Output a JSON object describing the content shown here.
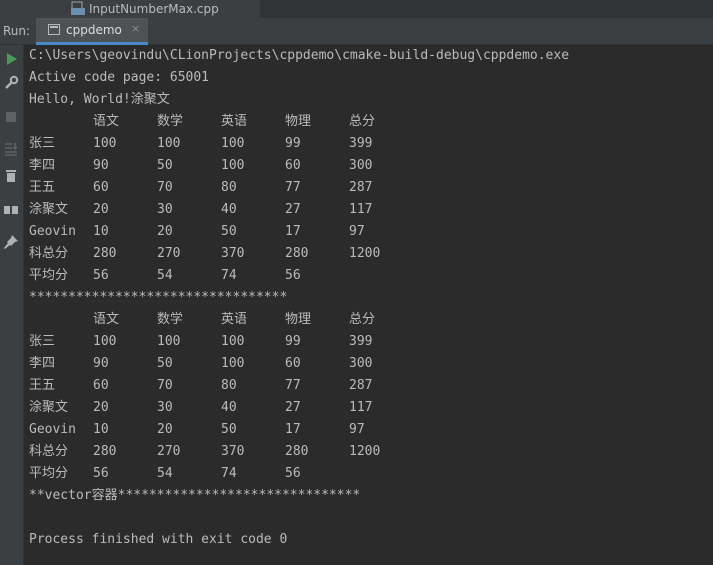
{
  "editor_tab": {
    "file_name": "InputNumberMax.cpp"
  },
  "run_panel": {
    "label": "Run:",
    "tab_name": "cppdemo",
    "close_glyph": "×"
  },
  "toolbar": {
    "icons": [
      "rerun-icon",
      "wrench-icon",
      "stop-icon",
      "scroll-to-end-icon",
      "trash-icon",
      "layout-icon",
      "pin-icon"
    ]
  },
  "colors": {
    "console_bg": "#2b2b2b",
    "console_text": "#bbbbbb",
    "run_green": "#499c54"
  },
  "console": {
    "path_line": "C:\\Users\\geovindu\\CLionProjects\\cppdemo\\cmake-build-debug\\cppdemo.exe",
    "code_page_line": "Active code page: 65001",
    "hello_line": "Hello, World!涂聚文",
    "table1": {
      "header": [
        "",
        "语文",
        "数学",
        "英语",
        "物理",
        "总分"
      ],
      "rows": [
        [
          "张三",
          "100",
          "100",
          "100",
          "99",
          "399"
        ],
        [
          "李四",
          "90",
          "50",
          "100",
          "60",
          "300"
        ],
        [
          "王五",
          "60",
          "70",
          "80",
          "77",
          "287"
        ],
        [
          "涂聚文",
          "20",
          "30",
          "40",
          "27",
          "117"
        ],
        [
          "Geovin",
          "10",
          "20",
          "50",
          "17",
          "97"
        ],
        [
          "科总分",
          "280",
          "270",
          "370",
          "280",
          "1200"
        ],
        [
          "平均分",
          "56",
          "54",
          "74",
          "56",
          ""
        ]
      ]
    },
    "separator_line": "*********************************",
    "table2": {
      "header": [
        "",
        "语文",
        "数学",
        "英语",
        "物理",
        "总分"
      ],
      "rows": [
        [
          "张三",
          "100",
          "100",
          "100",
          "99",
          "399"
        ],
        [
          "李四",
          "90",
          "50",
          "100",
          "60",
          "300"
        ],
        [
          "王五",
          "60",
          "70",
          "80",
          "77",
          "287"
        ],
        [
          "涂聚文",
          "20",
          "30",
          "40",
          "27",
          "117"
        ],
        [
          "Geovin",
          "10",
          "20",
          "50",
          "17",
          "97"
        ],
        [
          "科总分",
          "280",
          "270",
          "370",
          "280",
          "1200"
        ],
        [
          "平均分",
          "56",
          "54",
          "74",
          "56",
          ""
        ]
      ]
    },
    "vector_line": "**vector容器*******************************",
    "exit_line": "Process finished with exit code 0"
  }
}
